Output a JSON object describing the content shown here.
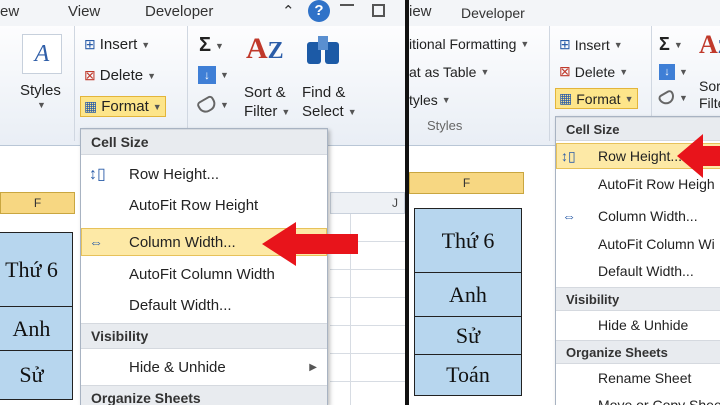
{
  "left": {
    "tabs": [
      "ew",
      "View",
      "Developer"
    ],
    "ribbon": {
      "styles_label": "Styles",
      "insert_label": "Insert",
      "delete_label": "Delete",
      "format_label": "Format",
      "sigma": "Σ",
      "sort_label_1": "Sort &",
      "sort_label_2": "Filter",
      "find_label_1": "Find &",
      "find_label_2": "Select"
    },
    "columns": {
      "f": "F",
      "j": "J"
    },
    "cells": [
      "Thứ 6",
      "Anh",
      "Sử"
    ],
    "menu": {
      "cell_size": "Cell Size",
      "row_height": "Row Height...",
      "autofit_row": "AutoFit Row Height",
      "column_width": "Column Width...",
      "autofit_column": "AutoFit Column Width",
      "default_width": "Default Width...",
      "visibility": "Visibility",
      "hide_unhide": "Hide & Unhide",
      "organize": "Organize Sheets"
    }
  },
  "right": {
    "tabs": [
      "iew",
      "Developer"
    ],
    "ribbon": {
      "cond_format": "itional Formatting",
      "as_table": "at as Table",
      "styles": "tyles",
      "styles_group": "Styles",
      "insert_label": "Insert",
      "delete_label": "Delete",
      "format_label": "Format",
      "sigma": "Σ",
      "sort_1": "Sor",
      "sort_2": "Filte"
    },
    "columns": {
      "f": "F"
    },
    "cells": [
      "Thứ 6",
      "Anh",
      "Sử",
      "Toán"
    ],
    "menu": {
      "cell_size": "Cell Size",
      "row_height": "Row Height...",
      "autofit_row": "AutoFit Row Heigh",
      "column_width": "Column Width...",
      "autofit_column": "AutoFit Column Wi",
      "default_width": "Default Width...",
      "visibility": "Visibility",
      "hide_unhide": "Hide & Unhide",
      "organize": "Organize Sheets",
      "rename": "Rename Sheet",
      "move_copy": "Move or Copy Shee"
    }
  },
  "colors": {
    "accent_highlight": "#fde58a",
    "arrow": "#e8141b",
    "cell_fill": "#b7d6ee",
    "column_header": "#f7d782"
  }
}
